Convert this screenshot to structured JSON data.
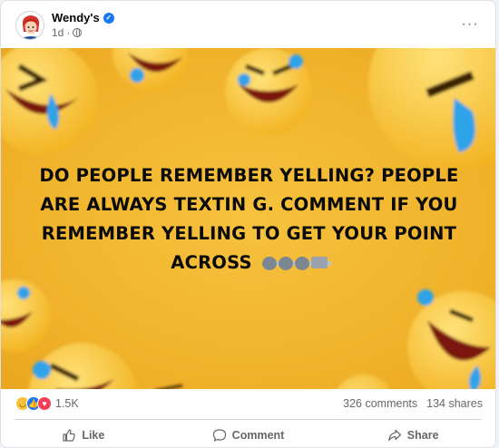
{
  "post": {
    "page_name": "Wendy's",
    "verified_icon": "verified-badge-icon",
    "time": "1d",
    "separator": "·",
    "audience_icon": "globe-icon",
    "more_icon": "more-dots-icon",
    "more_label": "···"
  },
  "media": {
    "text_main": "DO PEOPLE REMEMBER YELLING? PEOPLE ARE ALWAYS TEXTIN G. COMMENT IF YOU REMEMBER YELLING TO GET YOUR POINT ACROSS",
    "emojis": [
      "speaking-head",
      "speaking-head",
      "speaking-head",
      "megaphone"
    ],
    "background_color": "#f0b12a",
    "decor": "face-with-tears-of-joy"
  },
  "stats": {
    "reactions": [
      "haha",
      "like",
      "love"
    ],
    "reaction_count": "1.5K",
    "comments": "326 comments",
    "shares": "134 shares"
  },
  "actions": {
    "like": "Like",
    "comment": "Comment",
    "share": "Share"
  },
  "colors": {
    "accent": "#1877f2",
    "muted_text": "#65676b",
    "love": "#f33e58"
  }
}
